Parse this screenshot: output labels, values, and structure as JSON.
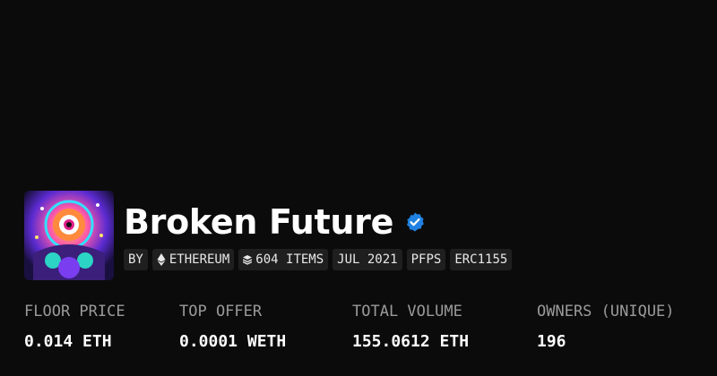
{
  "collection": {
    "name": "Broken Future",
    "verified": true,
    "avatar_icon": "collection-avatar-image"
  },
  "tags": [
    {
      "label": "BY",
      "icon": null
    },
    {
      "label": "ETHEREUM",
      "icon": "ethereum-icon"
    },
    {
      "label": "604 ITEMS",
      "icon": "layers-icon"
    },
    {
      "label": "JUL 2021",
      "icon": null
    },
    {
      "label": "PFPS",
      "icon": null
    },
    {
      "label": "ERC1155",
      "icon": null
    }
  ],
  "stats": [
    {
      "label": "FLOOR PRICE",
      "value": "0.014 ETH"
    },
    {
      "label": "TOP OFFER",
      "value": "0.0001 WETH"
    },
    {
      "label": "TOTAL VOLUME",
      "value": "155.0612 ETH"
    },
    {
      "label": "OWNERS (UNIQUE)",
      "value": "196"
    }
  ],
  "colors": {
    "background": "#0b0b0b",
    "tag_background": "#1f1f1f",
    "verified_blue": "#2081e2",
    "label_gray": "#9a9a9a"
  }
}
